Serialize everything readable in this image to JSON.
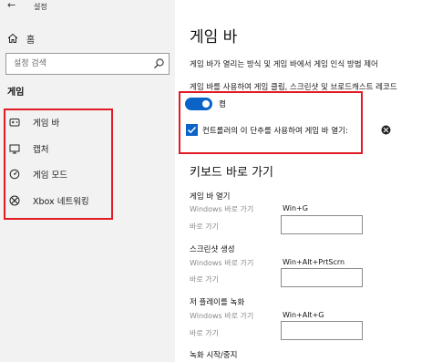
{
  "window": {
    "back_glyph": "←",
    "title": "설정"
  },
  "sidebar": {
    "home_label": "홈",
    "search_placeholder": "설정 검색",
    "section": "게임",
    "items": [
      {
        "label": "게임 바",
        "icon": "game-bar-icon"
      },
      {
        "label": "캡처",
        "icon": "capture-icon"
      },
      {
        "label": "게임 모드",
        "icon": "game-mode-icon"
      },
      {
        "label": "Xbox 네트워킹",
        "icon": "xbox-icon"
      }
    ]
  },
  "main": {
    "title": "게임 바",
    "desc1": "게임 바가 열리는 방식 및 게임 바에서 게임 인식 방법 제어",
    "desc2": "게임 바를 사용하여 게임 클립, 스크린샷 및 브로드캐스트 레코드",
    "toggle": {
      "state_label": "켬",
      "on": true
    },
    "checkbox": {
      "label": "컨트롤러의 이 단추를 사용하여 게임 바 열기:",
      "checked": true
    },
    "shortcuts_heading": "키보드 바로 가기",
    "groups": [
      {
        "title": "게임 바 열기",
        "windows_label": "Windows 바로 가기",
        "windows_value": "Win+G",
        "custom_label": "바로 가기"
      },
      {
        "title": "스크린샷 생성",
        "windows_label": "Windows 바로 가기",
        "windows_value": "Win+Alt+PrtScrn",
        "custom_label": "바로 가기"
      },
      {
        "title": "저 플레이를 녹화",
        "windows_label": "Windows 바로 가기",
        "windows_value": "Win+Alt+G",
        "custom_label": "바로 가기"
      },
      {
        "title": "녹화 시작/중지"
      }
    ]
  },
  "colors": {
    "accent": "#0a64c8",
    "highlight": "#e01b24",
    "sidebar_bg": "#f2f2f2"
  }
}
